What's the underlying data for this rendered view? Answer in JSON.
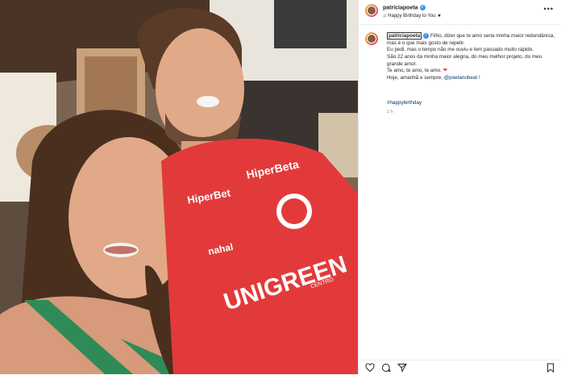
{
  "post": {
    "username": "patriciapoeta",
    "audio": "♫ Happy Birthday to You ★",
    "more": "•••"
  },
  "photo_overlay": {
    "jersey_sponsor_top": "HiperBeta",
    "jersey_left": "HiperBet",
    "jersey_brand": "nahal",
    "jersey_sponsor_main": "UNIGREEN",
    "jersey_sponsor_small": "CENTRO"
  },
  "caption": {
    "author": "patriciapoeta",
    "line1": "Filho, dizer que te amo seria minha maior redundância, mas é o que mais gosto de repetir.",
    "line2": "Eu pedi, mas o tempo não me ouviu e tem passado muito rápido.",
    "line3": "São 22 anos da minha maior alegria, do meu melhor projeto, do meu grande amor.",
    "line4": "Te amo, te amo, te amo.",
    "line4_heart": "❤",
    "line5_prefix": "Hoje, amanhã e sempre, ",
    "line5_mention": "@poetanobeat",
    "line5_suffix": " !",
    "hashtag": "#happybirthday",
    "time": "2 h"
  },
  "actions": {
    "like_icon": "heart-icon",
    "comment_icon": "comment-icon",
    "share_icon": "share-icon",
    "save_icon": "bookmark-icon"
  }
}
